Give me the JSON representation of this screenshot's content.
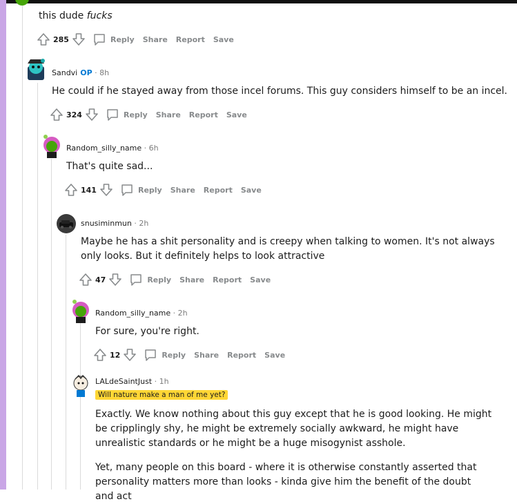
{
  "comments": [
    {
      "author": "",
      "age": "",
      "body": "this dude ",
      "body_em": "fucks",
      "score": "285"
    },
    {
      "author": "Sandvi",
      "op": "OP",
      "age": "· 8h",
      "body": "He could if he stayed away from those incel forums. This guy considers himself to be an incel.",
      "score": "324"
    },
    {
      "author": "Random_silly_name",
      "age": "· 6h",
      "body": "That's quite sad...",
      "score": "141"
    },
    {
      "author": "snusiminmun",
      "age": "· 2h",
      "body": "Maybe he has a shit personality and is creepy when talking to women. It's not always only looks. But it definitely helps to look attractive",
      "score": "47"
    },
    {
      "author": "Random_silly_name",
      "age": "· 2h",
      "body": "For sure, you're right.",
      "score": "12"
    },
    {
      "author": "LALdeSaintJust",
      "age": "· 1h",
      "flair": "Will nature make a man of me yet?",
      "paragraphs": [
        "Exactly. We know nothing about this guy except that he is good looking. He might be cripplingly shy, he might be extremely socially awkward, he might have unrealistic standards or he might be a huge misogynist asshole.",
        "Yet, many people on this board - where it is otherwise constantly asserted that personality matters more than looks - kinda give him the benefit of the doubt and act"
      ]
    }
  ],
  "actions": {
    "reply": "Reply",
    "share": "Share",
    "report": "Report",
    "save": "Save"
  },
  "colors": {
    "page_bg": "#ffffff",
    "left_bar": "#c9a6e6",
    "op": "#0079d3",
    "flair_bg": "#ffd635",
    "meta": "#7c7c7c",
    "action": "#878a8c"
  }
}
